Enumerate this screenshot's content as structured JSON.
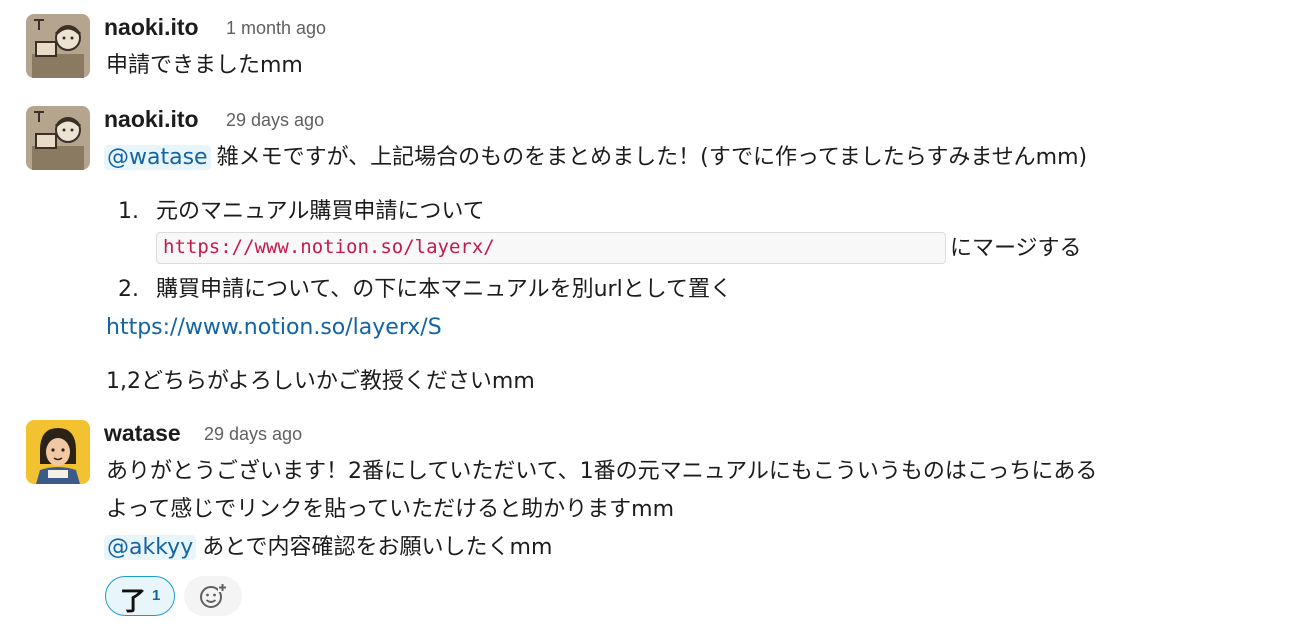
{
  "messages": [
    {
      "author": "naoki.ito",
      "time": "1 month ago",
      "text": "申請できましたmm"
    },
    {
      "author": "naoki.ito",
      "time": "29 days ago",
      "mention": "@watase",
      "text": "雑メモですが、上記場合のものをまとめました！(すでに作ってましたらすみませんmm)",
      "list": [
        {
          "num": "1.",
          "text": "元のマニュアル購買申請について",
          "code": "https://www.notion.so/layerx/",
          "after_code": "にマージする"
        },
        {
          "num": "2.",
          "text": "購買申請について、の下に本マニュアルを別urlとして置く"
        }
      ],
      "link": "https://www.notion.so/layerx/S",
      "closing": "1,2どちらがよろしいかご教授くださいmm"
    },
    {
      "author": "watase",
      "time": "29 days ago",
      "line1": "ありがとうございます！2番にしていただいて、1番の元マニュアルにもこういうものはこっちにある",
      "line2": "よって感じでリンクを貼っていただけると助かりますmm",
      "mention": "@akkyy",
      "line3": "あとで内容確認をお願いしたくmm",
      "reaction": {
        "emoji": "了",
        "count": "1"
      }
    }
  ],
  "icons": {
    "add_reaction": "add-reaction-icon"
  },
  "colors": {
    "mention_bg": "#e8f5fa",
    "mention_fg": "#1264a3",
    "link": "#1264a3",
    "code_fg": "#c41a4e"
  }
}
